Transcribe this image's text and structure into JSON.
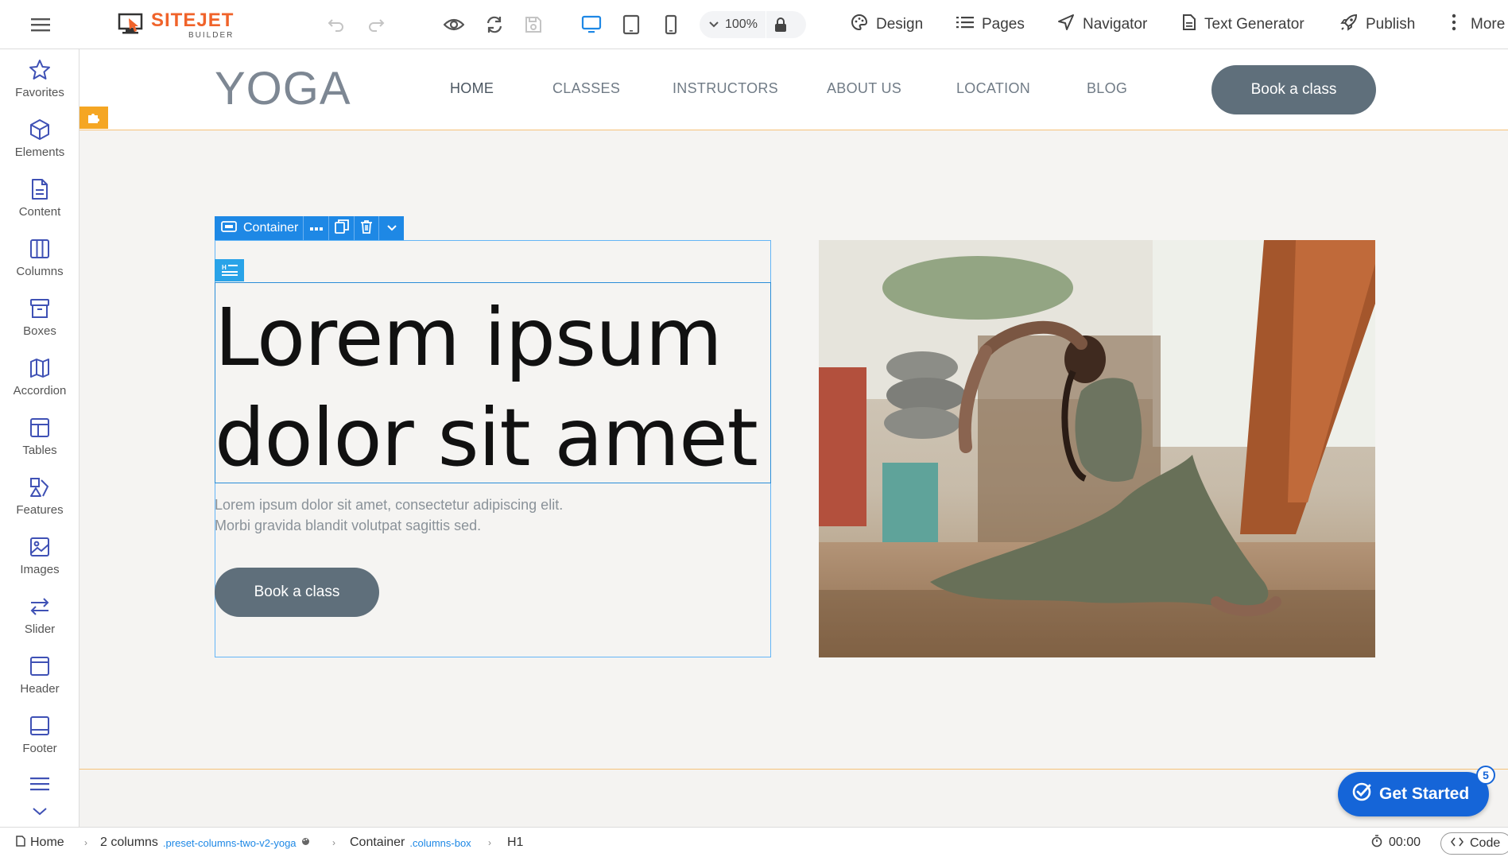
{
  "toolbar": {
    "app_name": "SITEJET",
    "app_sub": "BUILDER",
    "zoom": "100%",
    "design": "Design",
    "pages": "Pages",
    "navigator": "Navigator",
    "text_generator": "Text Generator",
    "publish": "Publish",
    "more": "More"
  },
  "sidebar": {
    "items": [
      {
        "label": "Favorites",
        "icon": "star-icon"
      },
      {
        "label": "Elements",
        "icon": "cube-icon"
      },
      {
        "label": "Content",
        "icon": "document-icon"
      },
      {
        "label": "Columns",
        "icon": "columns-icon"
      },
      {
        "label": "Boxes",
        "icon": "box-icon"
      },
      {
        "label": "Accordion",
        "icon": "map-icon"
      },
      {
        "label": "Tables",
        "icon": "table-icon"
      },
      {
        "label": "Features",
        "icon": "features-icon"
      },
      {
        "label": "Images",
        "icon": "image-icon"
      },
      {
        "label": "Slider",
        "icon": "slider-icon"
      },
      {
        "label": "Header",
        "icon": "header-icon"
      },
      {
        "label": "Footer",
        "icon": "footer-icon"
      }
    ]
  },
  "site": {
    "logo": "YOGA",
    "nav": [
      "HOME",
      "CLASSES",
      "INSTRUCTORS",
      "ABOUT US",
      "LOCATION",
      "BLOG"
    ],
    "cta": "Book a class"
  },
  "editor": {
    "container_label": "Container"
  },
  "hero": {
    "heading_line1": "Lorem ipsum",
    "heading_line2": "dolor sit amet",
    "para_line1": "Lorem ipsum dolor sit amet, consectetur adipiscing elit.",
    "para_line2": "Morbi gravida blandit volutpat sagittis sed.",
    "button": "Book a class"
  },
  "get_started": {
    "label": "Get Started",
    "badge": "5"
  },
  "breadcrumb": {
    "home": "Home",
    "columns": "2 columns",
    "columns_class": ".preset-columns-two-v2-yoga",
    "container": "Container",
    "container_class": ".columns-box",
    "h1": "H1"
  },
  "status": {
    "timer": "00:00",
    "code": "Code"
  },
  "colors": {
    "accent": "#1e88e5",
    "brand": "#f0632a",
    "site_button": "#5f6f7b",
    "highlight": "#f5a623"
  }
}
